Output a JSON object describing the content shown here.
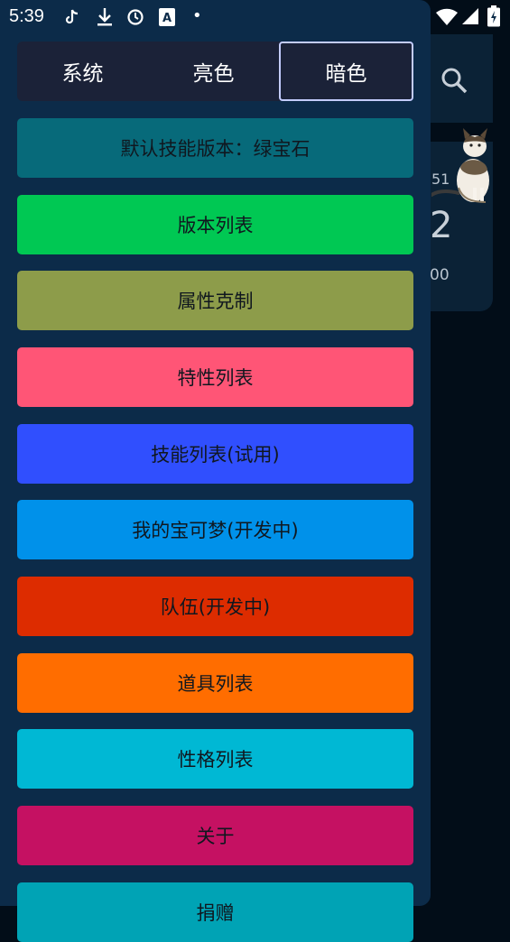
{
  "status_bar": {
    "time": "5:39",
    "icons": [
      "tiktok-icon",
      "download-icon",
      "sync-icon",
      "a-icon",
      "dot-icon",
      "wifi-icon",
      "signal-icon",
      "battery-icon"
    ],
    "dot": "•"
  },
  "background": {
    "number_top": "51",
    "glyph": "2",
    "number_bottom": "00"
  },
  "theme_selector": {
    "options": [
      "系统",
      "亮色",
      "暗色"
    ],
    "selected": "暗色"
  },
  "menu": [
    {
      "label": "默认技能版本：绿宝石",
      "color": "#076a7a"
    },
    {
      "label": "版本列表",
      "color": "#00c853"
    },
    {
      "label": "属性克制",
      "color": "#8d9c4a"
    },
    {
      "label": "特性列表",
      "color": "#ff5576"
    },
    {
      "label": "技能列表(试用)",
      "color": "#304ffe"
    },
    {
      "label": "我的宝可梦(开发中)",
      "color": "#0091ea"
    },
    {
      "label": "队伍(开发中)",
      "color": "#dd2c00"
    },
    {
      "label": "道具列表",
      "color": "#ff6d00"
    },
    {
      "label": "性格列表",
      "color": "#00b8d4"
    },
    {
      "label": "关于",
      "color": "#c51162"
    },
    {
      "label": "捐赠",
      "color": "#00a3b5"
    }
  ]
}
